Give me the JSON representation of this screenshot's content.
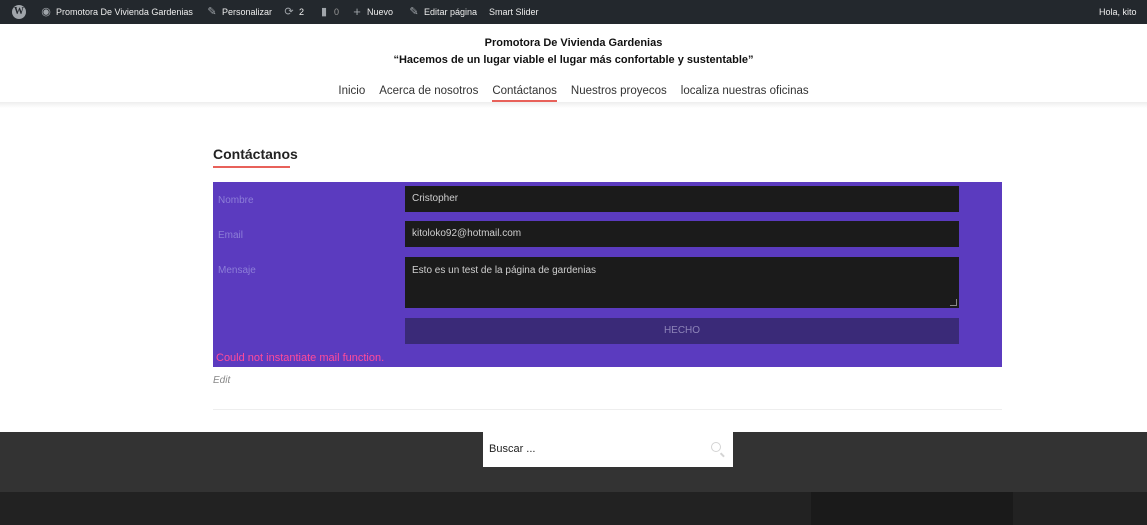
{
  "admin_bar": {
    "site_name": "Promotora De Vivienda Gardenias",
    "customize": "Personalizar",
    "updates_count": "2",
    "comments_count": "0",
    "new": "Nuevo",
    "edit_page": "Editar página",
    "smart_slider": "Smart Slider",
    "greeting": "Hola, kito"
  },
  "header": {
    "title": "Promotora De Vivienda Gardenias",
    "tagline": "“Hacemos de un lugar viable el lugar más confortable y sustentable”"
  },
  "nav": {
    "items": [
      {
        "label": "Inicio",
        "active": false
      },
      {
        "label": "Acerca de nosotros",
        "active": false
      },
      {
        "label": "Contáctanos",
        "active": true
      },
      {
        "label": "Nuestros proyecos",
        "active": false
      },
      {
        "label": "localiza nuestras oficinas",
        "active": false
      }
    ]
  },
  "page": {
    "heading": "Contáctanos"
  },
  "form": {
    "name_label": "Nombre",
    "name_value": "Cristopher",
    "email_label": "Email",
    "email_value": "kitoloko92@hotmail.com",
    "message_label": "Mensaje",
    "message_value": "Esto es un test de la página de gardenias",
    "submit_label": "HECHO",
    "error": "Could not instantiate mail function."
  },
  "edit_link": "Edit",
  "footer": {
    "search_placeholder": "Buscar ..."
  },
  "colors": {
    "admin_bar_bg": "#23282d",
    "form_bg": "#5b3bbf",
    "accent_underline": "#e8615a",
    "error_text": "#ff4b9a",
    "footer_bg": "#333333"
  }
}
